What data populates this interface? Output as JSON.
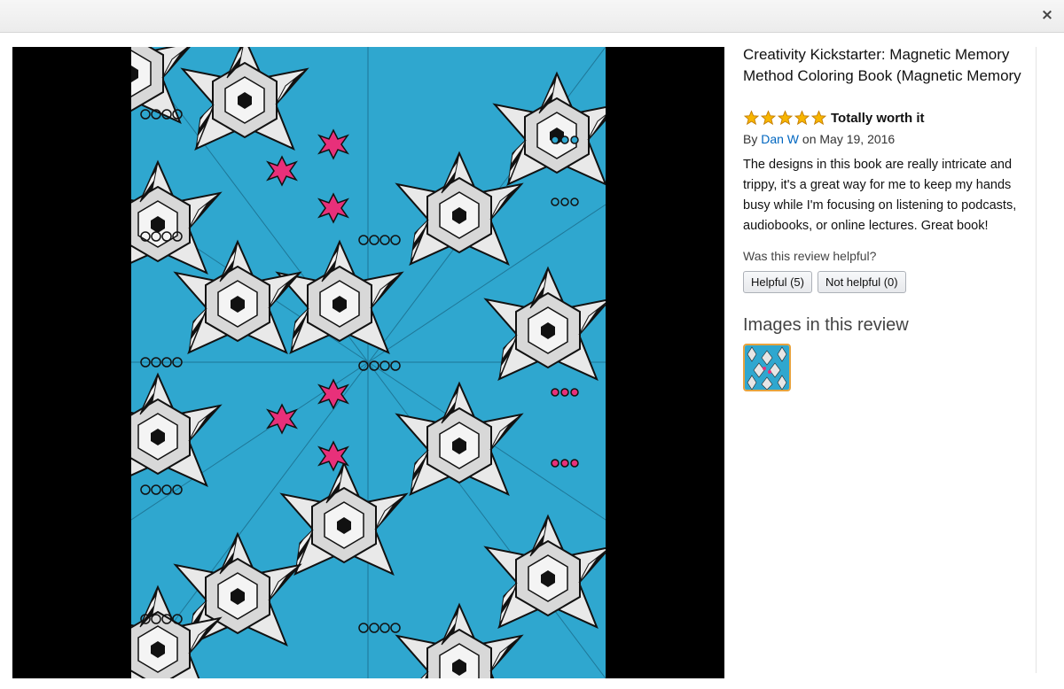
{
  "window": {
    "close_label": "×"
  },
  "viewer": {
    "image_alt": "Colored kaleidoscope pattern page"
  },
  "product": {
    "title": "Creativity Kickstarter: Magnetic Memory Method Coloring Book (Magnetic Memory"
  },
  "review": {
    "rating": 5,
    "rating_max": 5,
    "title": "Totally worth it",
    "by_prefix": "By",
    "author": "Dan W",
    "date_text": "on May 19, 2016",
    "body": "The designs in this book are really intricate and trippy, it's a great way for me to keep my hands busy while I'm focusing on listening to podcasts, audiobooks, or online lectures. Great book!",
    "helpful_question": "Was this review helpful?",
    "helpful_label": "Helpful (5)",
    "not_helpful_label": "Not helpful (0)"
  },
  "images_section": {
    "heading": "Images in this review"
  },
  "colors": {
    "link": "#0066c0",
    "star": "#f7b500",
    "thumb_border": "#e7a33e",
    "art_blue": "#2fa7cf",
    "art_pink": "#e8307a"
  }
}
